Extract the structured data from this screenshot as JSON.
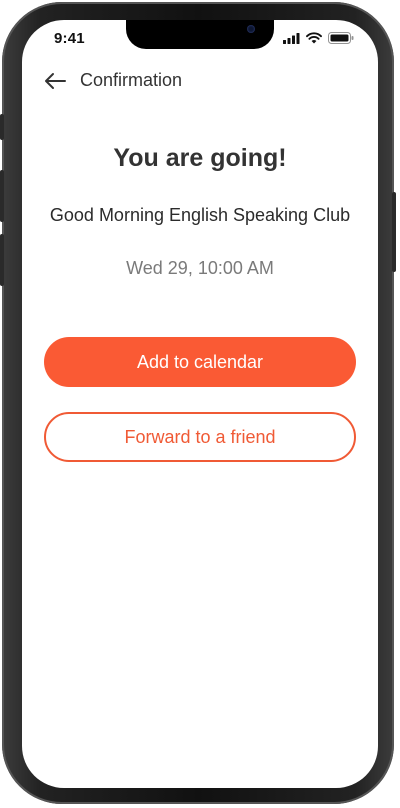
{
  "status_bar": {
    "time": "9:41"
  },
  "header": {
    "title": "Confirmation",
    "back_icon": "arrow-left-icon"
  },
  "confirmation": {
    "heading": "You are going!",
    "event_name": "Good Morning English Speaking Club",
    "event_datetime": "Wed 29, 10:00 AM"
  },
  "actions": {
    "add_to_calendar_label": "Add to calendar",
    "forward_label": "Forward to a friend"
  },
  "colors": {
    "accent": "#fa5a34",
    "accent_outline": "#f05a35"
  }
}
